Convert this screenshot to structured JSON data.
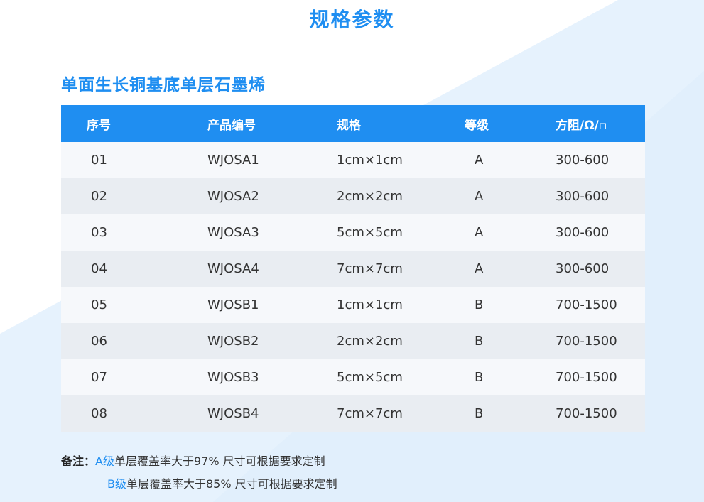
{
  "title": "规格参数",
  "section_title": "单面生长铜基底单层石墨烯",
  "table": {
    "headers": [
      "序号",
      "产品编号",
      "规格",
      "等级",
      "方阻/Ω/▫"
    ],
    "rows": [
      [
        "01",
        "WJOSA1",
        "1cm×1cm",
        "A",
        "300-600"
      ],
      [
        "02",
        "WJOSA2",
        "2cm×2cm",
        "A",
        "300-600"
      ],
      [
        "03",
        "WJOSA3",
        "5cm×5cm",
        "A",
        "300-600"
      ],
      [
        "04",
        "WJOSA4",
        "7cm×7cm",
        "A",
        "300-600"
      ],
      [
        "05",
        "WJOSB1",
        "1cm×1cm",
        "B",
        "700-1500"
      ],
      [
        "06",
        "WJOSB2",
        "2cm×2cm",
        "B",
        "700-1500"
      ],
      [
        "07",
        "WJOSB3",
        "5cm×5cm",
        "B",
        "700-1500"
      ],
      [
        "08",
        "WJOSB4",
        "7cm×7cm",
        "B",
        "700-1500"
      ]
    ]
  },
  "notes": {
    "label": "备注：",
    "lines": [
      {
        "grade": "A级",
        "text": "单层覆盖率大于97%   尺寸可根据要求定制"
      },
      {
        "grade": "B级",
        "text": "单层覆盖率大于85%   尺寸可根据要求定制"
      }
    ]
  },
  "colors": {
    "accent": "#1f8ef1",
    "row_odd": "#f6f8fb",
    "row_even": "#e9edf2",
    "background_shape": "#e6f2fd"
  }
}
